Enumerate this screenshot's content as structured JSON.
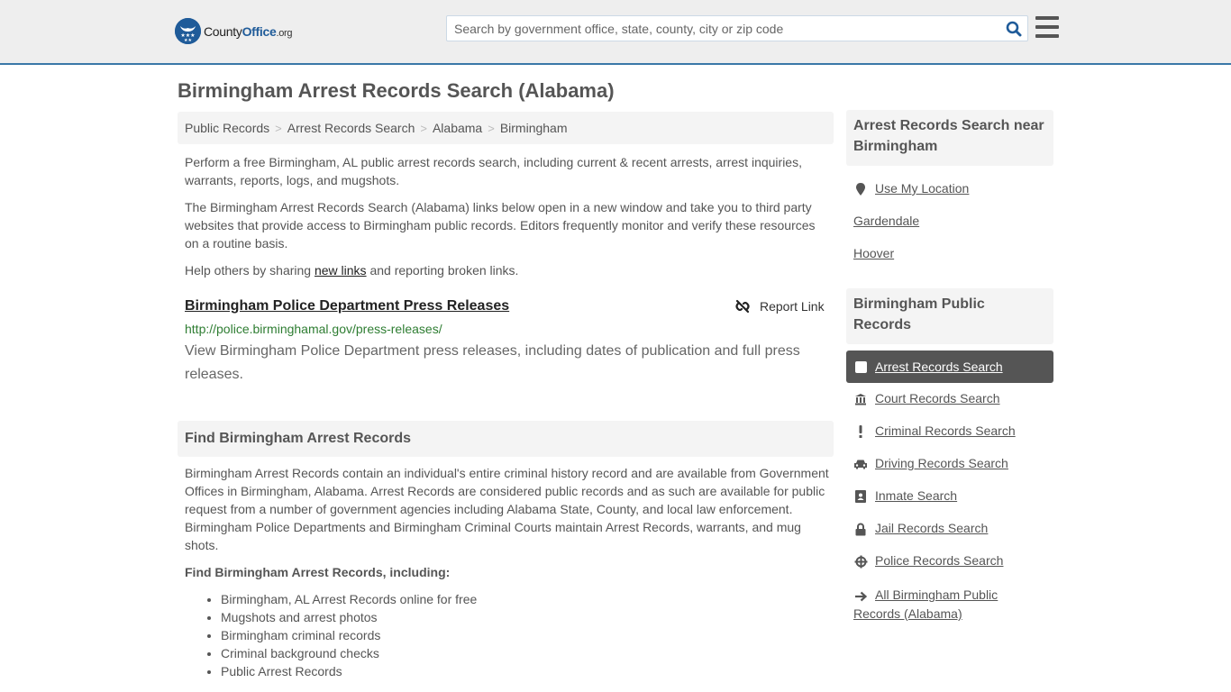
{
  "header": {
    "logo": {
      "name_part1": "County",
      "name_part2": "Office",
      "tld": ".org"
    },
    "search": {
      "placeholder": "Search by government office, state, county, city or zip code",
      "value": ""
    },
    "colors": {
      "brand": "#1f5b99",
      "border_accent": "#3a78a8"
    }
  },
  "page": {
    "title": "Birmingham Arrest Records Search (Alabama)"
  },
  "breadcrumb": [
    {
      "label": "Public Records"
    },
    {
      "label": "Arrest Records Search"
    },
    {
      "label": "Alabama"
    },
    {
      "label": "Birmingham"
    }
  ],
  "breadcrumb_separator": ">",
  "intro": {
    "p1": "Perform a free Birmingham, AL public arrest records search, including current & recent arrests, arrest inquiries, warrants, reports, logs, and mugshots.",
    "p2": "The Birmingham Arrest Records Search (Alabama) links below open in a new window and take you to third party websites that provide access to Birmingham public records. Editors frequently monitor and verify these resources on a routine basis.",
    "p3_before": "Help others by sharing ",
    "p3_link": "new links",
    "p3_after": " and reporting broken links."
  },
  "results": [
    {
      "title": "Birmingham Police Department Press Releases",
      "url": "http://police.birminghamal.gov/press-releases/",
      "description": "View Birmingham Police Department press releases, including dates of publication and full press releases.",
      "report_label": "Report Link"
    }
  ],
  "find_section": {
    "heading": "Find Birmingham Arrest Records",
    "body": "Birmingham Arrest Records contain an individual's entire criminal history record and are available from Government Offices in Birmingham, Alabama. Arrest Records are considered public records and as such are available for public request from a number of government agencies including Alabama State, County, and local law enforcement. Birmingham Police Departments and Birmingham Criminal Courts maintain Arrest Records, warrants, and mug shots.",
    "subheading": "Find Birmingham Arrest Records, including:",
    "bullets": [
      "Birmingham, AL Arrest Records online for free",
      "Mugshots and arrest photos",
      "Birmingham criminal records",
      "Criminal background checks",
      "Public Arrest Records"
    ]
  },
  "sidebar": {
    "nearby": {
      "heading": "Arrest Records Search near Birmingham",
      "use_location": "Use My Location",
      "cities": [
        "Gardendale",
        "Hoover"
      ]
    },
    "public_records": {
      "heading": "Birmingham Public Records",
      "items": [
        {
          "label": "Arrest Records Search",
          "icon": "square-icon",
          "active": true
        },
        {
          "label": "Court Records Search",
          "icon": "courthouse-icon",
          "active": false
        },
        {
          "label": "Criminal Records Search",
          "icon": "exclamation-icon",
          "active": false
        },
        {
          "label": "Driving Records Search",
          "icon": "car-icon",
          "active": false
        },
        {
          "label": "Inmate Search",
          "icon": "id-badge-icon",
          "active": false
        },
        {
          "label": "Jail Records Search",
          "icon": "lock-icon",
          "active": false
        },
        {
          "label": "Police Records Search",
          "icon": "crosshair-icon",
          "active": false
        }
      ],
      "all_link": "All Birmingham Public Records (Alabama)"
    }
  }
}
